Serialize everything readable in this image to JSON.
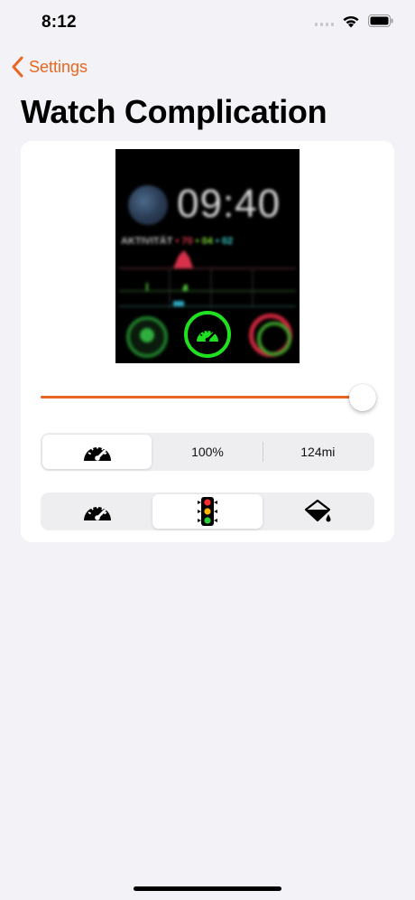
{
  "status": {
    "time": "8:12"
  },
  "nav": {
    "back_label": "Settings",
    "title": "Watch Complication"
  },
  "watch_preview": {
    "time": "09:40",
    "activity_label": "AKTIVITÄT",
    "activity_move": "• 70",
    "activity_exercise": "• 04",
    "activity_stand": "• 02"
  },
  "slider": {
    "value": 0.96
  },
  "segment_display": {
    "items": [
      {
        "icon": "speedometer-icon",
        "label": ""
      },
      {
        "icon": "",
        "label": "100%"
      },
      {
        "icon": "",
        "label": "124mi"
      }
    ],
    "selected_index": 0
  },
  "segment_style": {
    "items": [
      {
        "icon": "speedometer-icon"
      },
      {
        "icon": "traffic-light-icon"
      },
      {
        "icon": "paint-bucket-icon"
      }
    ],
    "selected_index": 1
  },
  "colors": {
    "accent": "#e8661f",
    "complication_ring": "#1fe11f",
    "background": "#f2f2f7"
  }
}
